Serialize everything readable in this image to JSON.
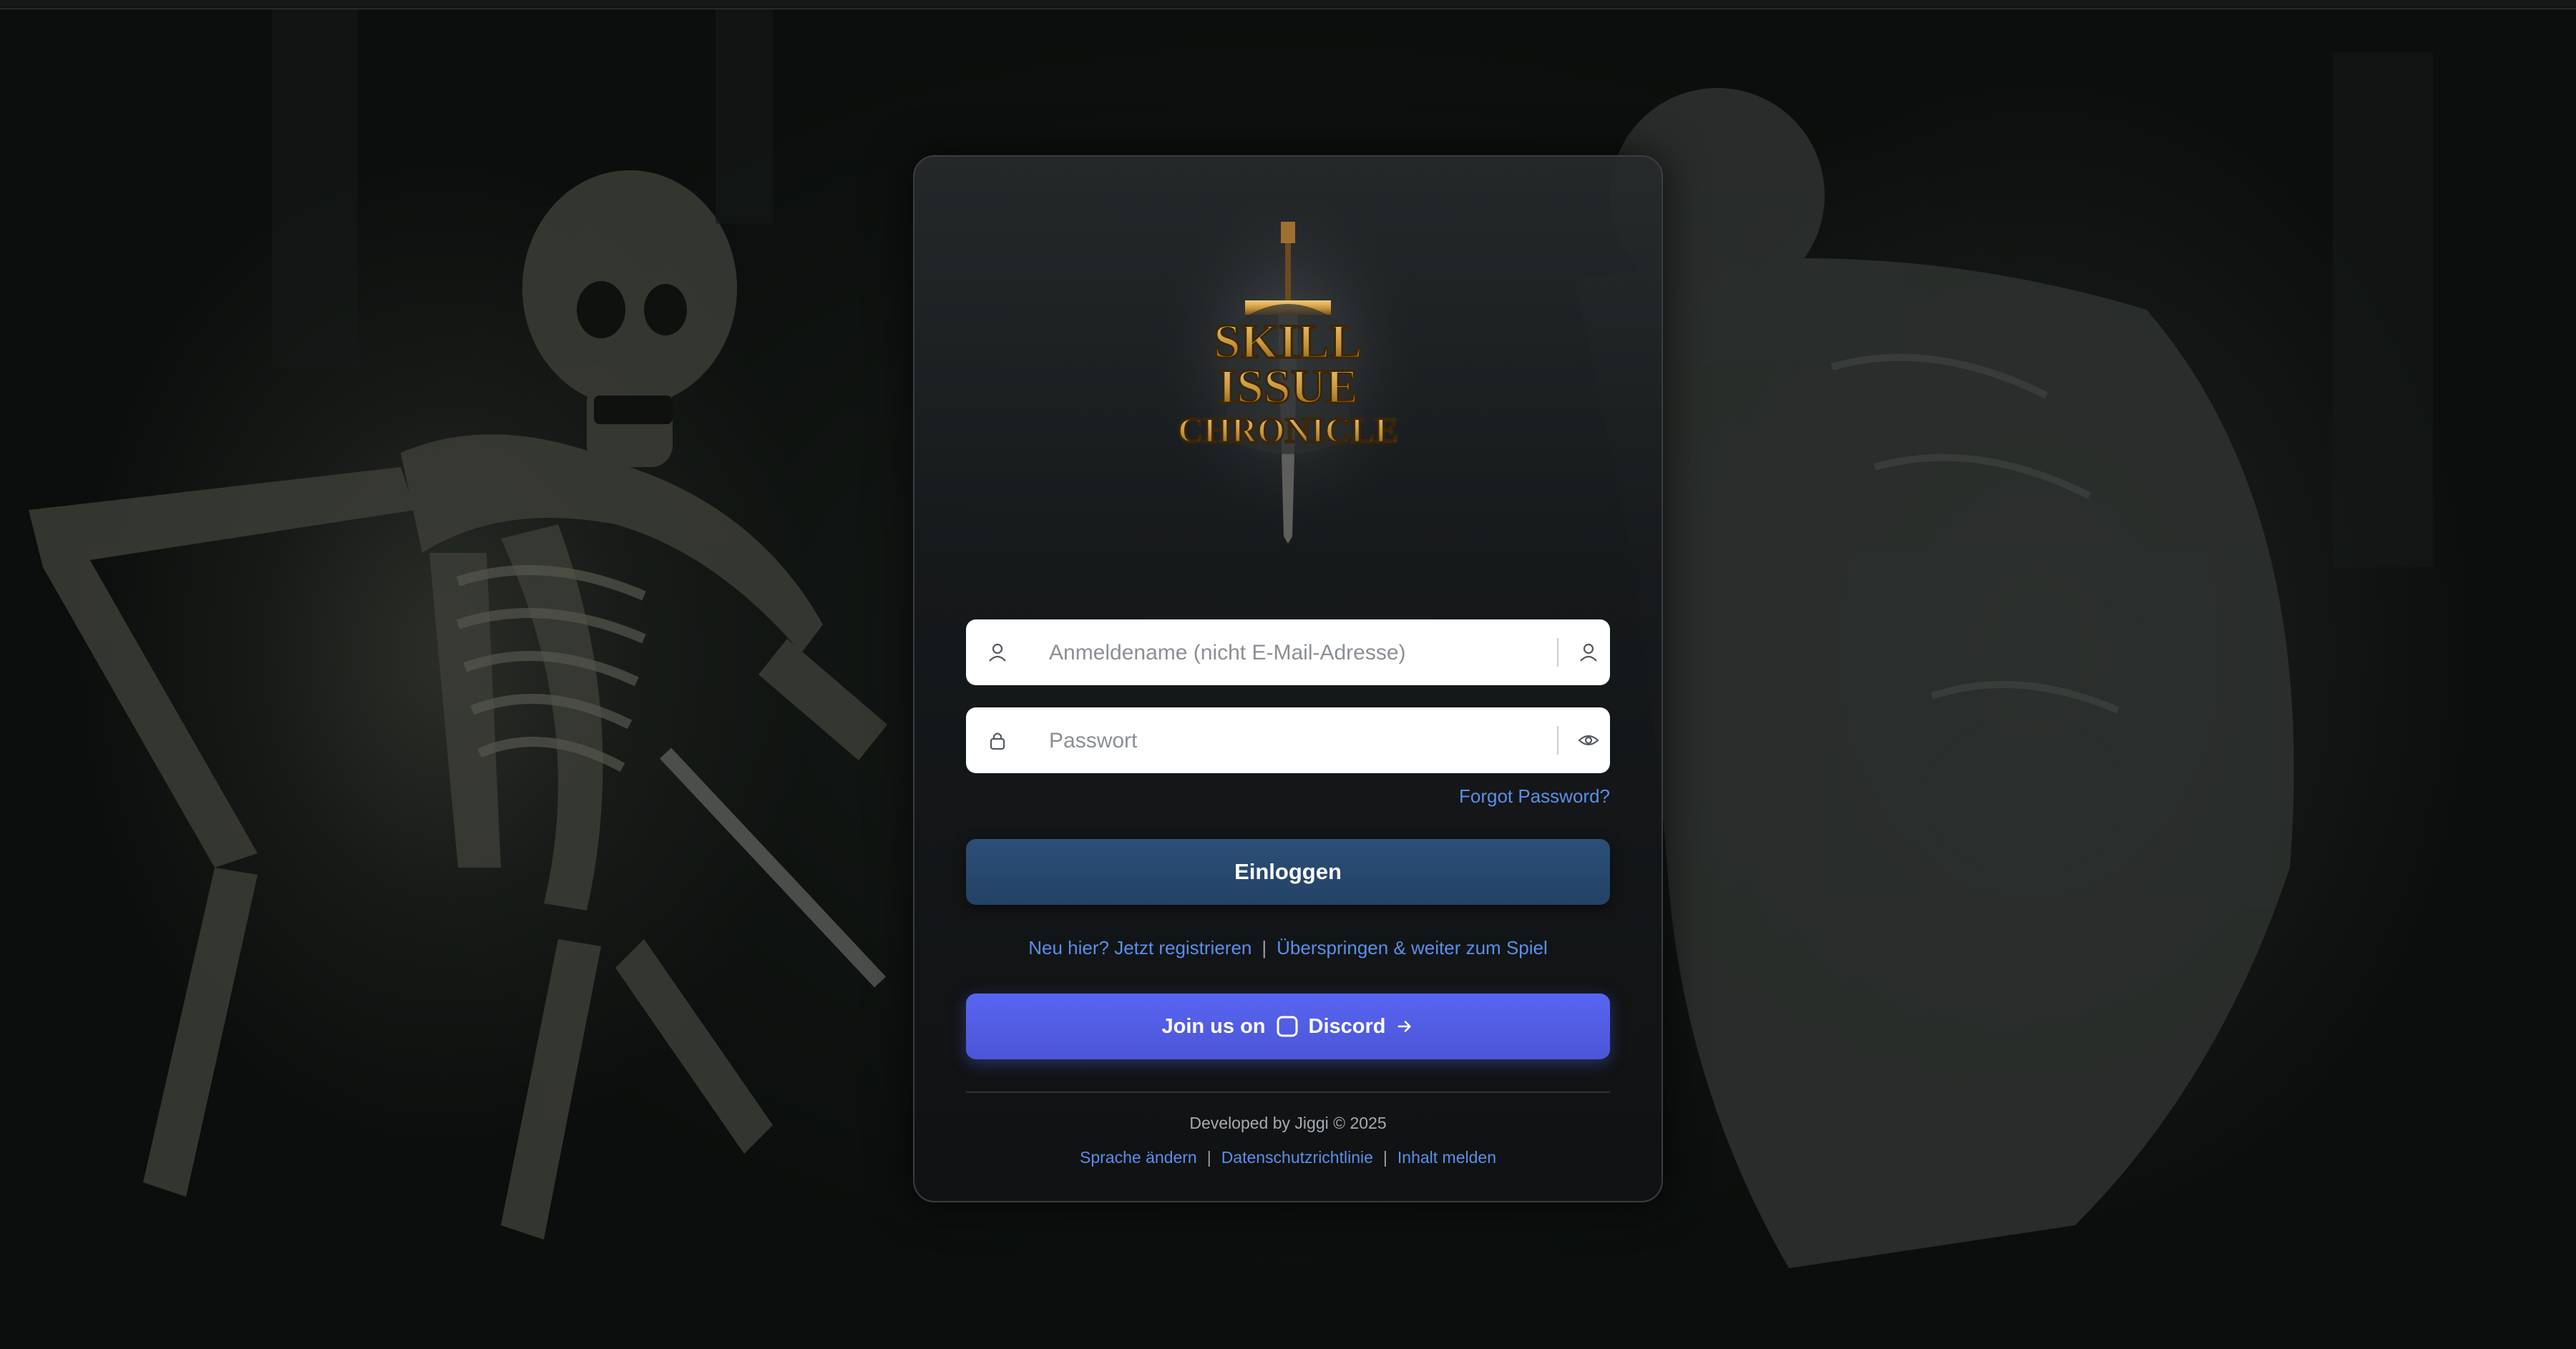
{
  "app": {
    "logo_text": [
      "SKILL",
      "ISSUE",
      "CHRONICLE"
    ]
  },
  "login": {
    "username_placeholder": "Anmeldename (nicht E-Mail-Adresse)",
    "password_placeholder": "Passwort",
    "forgot_password": "Forgot Password?",
    "login_button": "Einloggen"
  },
  "links": {
    "register": "Neu hier? Jetzt registrieren",
    "separator": "|",
    "skip": "Überspringen & weiter zum Spiel"
  },
  "discord": {
    "prefix": "Join us on",
    "name": "Discord",
    "icon": "discord-icon",
    "arrow_icon": "arrow-right-icon"
  },
  "footer": {
    "credits": "Developed by Jiggi © 2025",
    "links": [
      "Sprache ändern",
      "Datenschutzrichtlinie",
      "Inhalt melden"
    ]
  },
  "colors": {
    "link": "#5b8fe8",
    "login_button": "#2c4f78",
    "discord_button": "#5865f2",
    "logo_gold": "#c8963c"
  },
  "icons": {
    "username_lead": "user-icon",
    "username_trail": "user-icon",
    "password_lead": "lock-icon",
    "password_trail": "eye-icon"
  }
}
